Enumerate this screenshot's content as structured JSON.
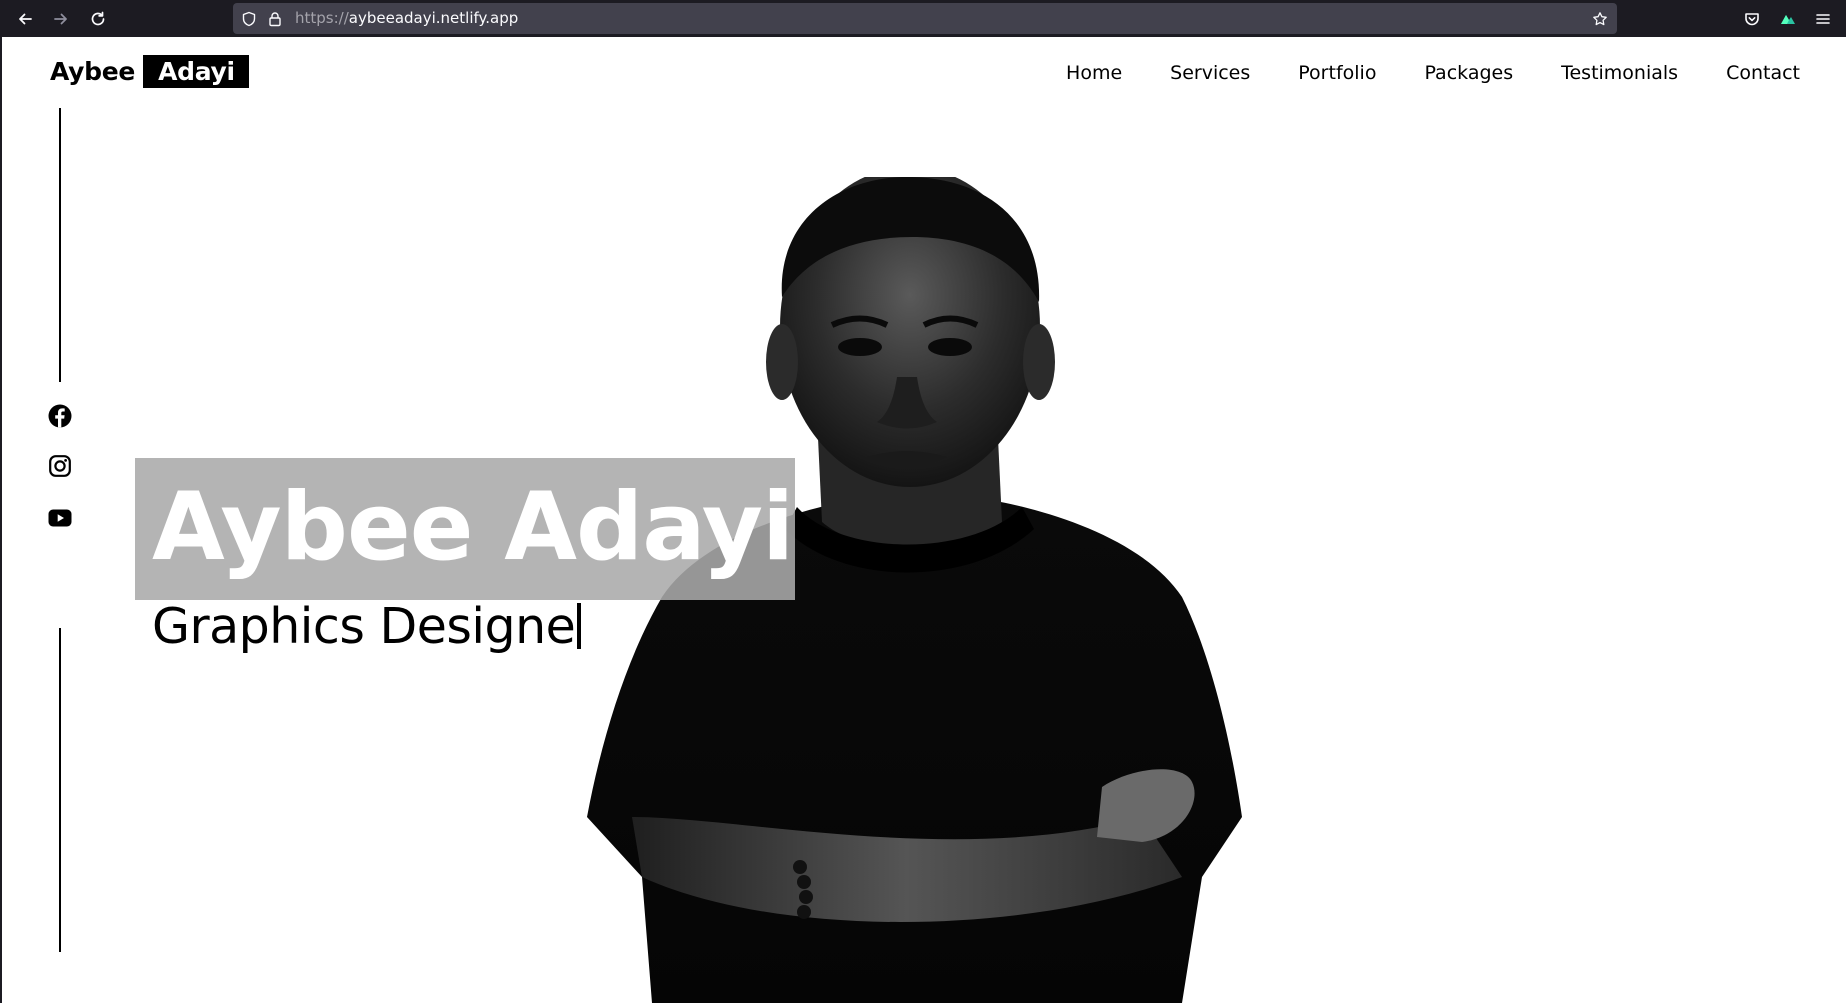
{
  "browser": {
    "url_scheme": "https://",
    "url_host": "aybeeadayi.netlify.app",
    "icons": {
      "back": "arrow-left-icon",
      "forward": "arrow-right-icon",
      "reload": "reload-icon",
      "tracking": "shield-icon",
      "lock": "lock-icon",
      "bookmark": "star-icon",
      "pocket": "pocket-icon",
      "extension": "vpn-extension-icon",
      "menu": "hamburger-menu-icon"
    }
  },
  "header": {
    "logo_first": "Aybee",
    "logo_second": "Adayi",
    "nav": [
      {
        "label": "Home"
      },
      {
        "label": "Services"
      },
      {
        "label": "Portfolio"
      },
      {
        "label": "Packages"
      },
      {
        "label": "Testimonials"
      },
      {
        "label": "Contact"
      }
    ]
  },
  "social": {
    "items": [
      {
        "icon": "facebook-icon"
      },
      {
        "icon": "instagram-icon"
      },
      {
        "icon": "youtube-icon"
      }
    ]
  },
  "hero": {
    "name": "Aybee Adayi",
    "role": "Graphics Designe",
    "portrait_alt": "black-and-white portrait of a man in a black t-shirt with arms crossed"
  },
  "colors": {
    "chrome_bg": "#1c1b22",
    "urlbar_bg": "#42414d",
    "page_bg": "#ffffff",
    "ink": "#000000",
    "name_overlay": "#aaaaaa"
  }
}
